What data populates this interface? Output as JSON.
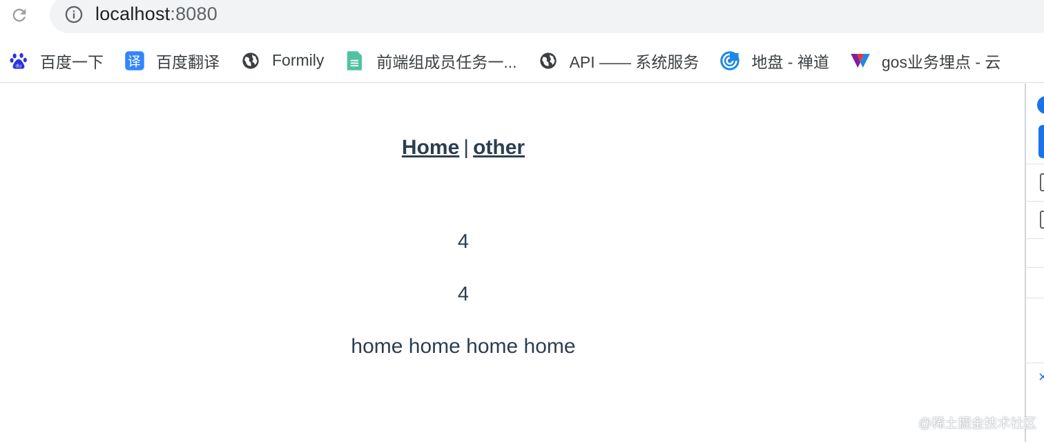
{
  "browser": {
    "reload_icon": "reload-icon",
    "info_icon": "info-icon",
    "url_host": "localhost",
    "url_port": ":8080"
  },
  "bookmarks": [
    {
      "label": "百度一下",
      "icon": "baidu-paw-icon",
      "color": "#2932e1"
    },
    {
      "label": "百度翻译",
      "icon": "translate-icon",
      "color": "#3385ff"
    },
    {
      "label": "Formily",
      "icon": "globe-icon",
      "color": "#3c4043"
    },
    {
      "label": "前端组成员任务一...",
      "icon": "sheet-doc-icon",
      "color": "#4fc3a1"
    },
    {
      "label": "API —— 系统服务",
      "icon": "globe-icon",
      "color": "#3c4043"
    },
    {
      "label": "地盘 - 禅道",
      "icon": "zentao-swirl-icon",
      "color": "#1e88e5"
    },
    {
      "label": "gos业务埋点 - 云",
      "icon": "v-logo-icon",
      "color": "#e53935"
    }
  ],
  "page": {
    "nav": {
      "home_label": "Home",
      "separator": "|",
      "other_label": "other"
    },
    "count_a": "4",
    "count_b": "4",
    "home_text": "home home home home"
  },
  "watermark": "@稀土掘金技术社区"
}
